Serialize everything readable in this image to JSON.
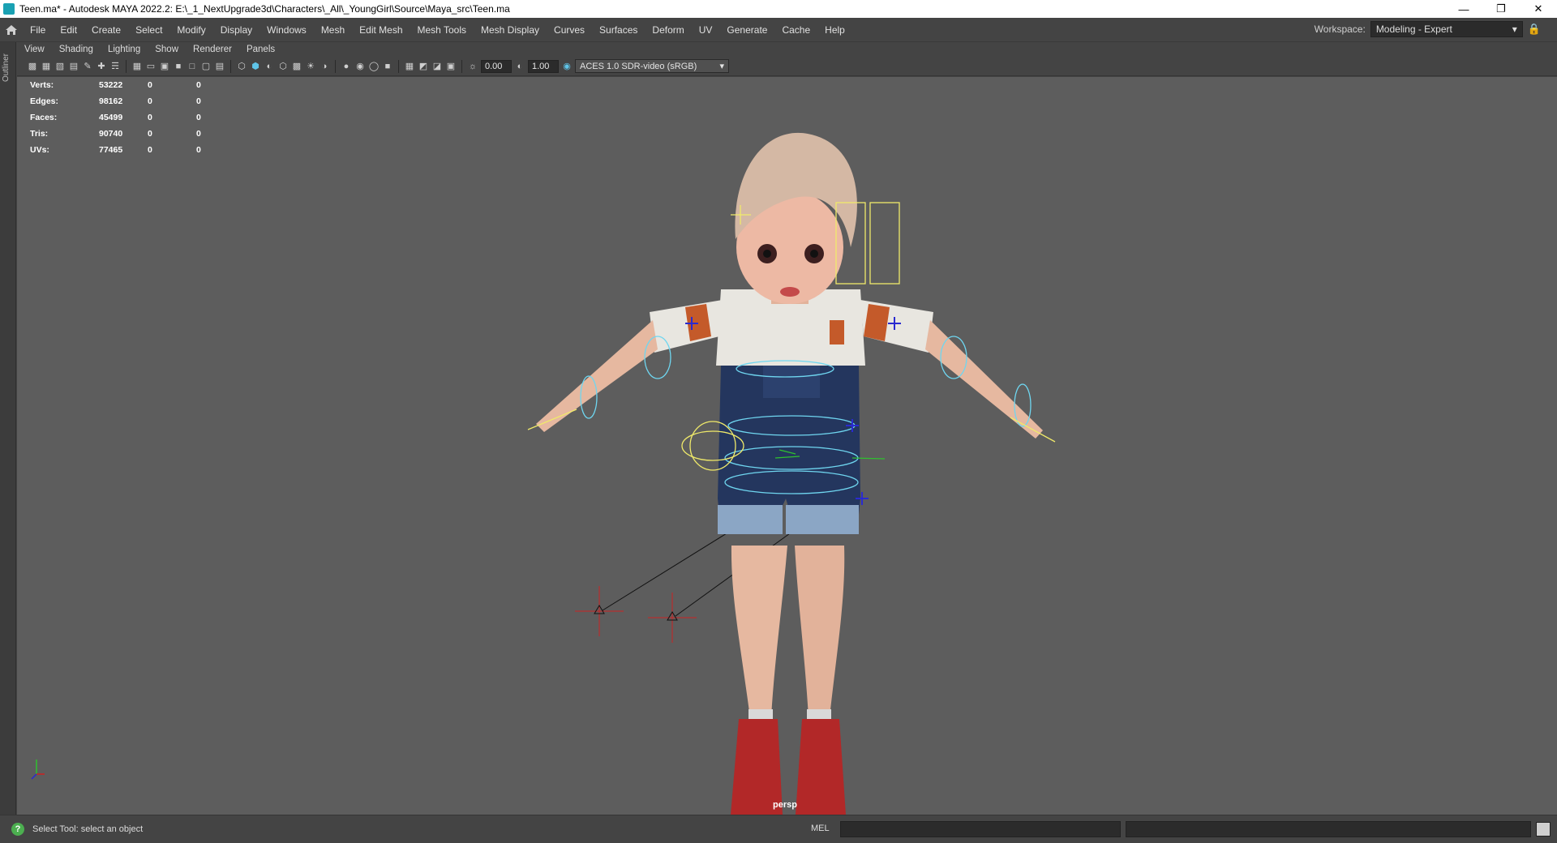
{
  "window": {
    "title": "Teen.ma* - Autodesk MAYA 2022.2: E:\\_1_NextUpgrade3d\\Characters\\_All\\_YoungGirl\\Source\\Maya_src\\Teen.ma",
    "buttons": [
      "minimize-icon",
      "restore-icon",
      "close-icon"
    ]
  },
  "menubar": {
    "items": [
      "File",
      "Edit",
      "Create",
      "Select",
      "Modify",
      "Display",
      "Windows",
      "Mesh",
      "Edit Mesh",
      "Mesh Tools",
      "Mesh Display",
      "Curves",
      "Surfaces",
      "Deform",
      "UV",
      "Generate",
      "Cache",
      "Help"
    ],
    "workspace_label": "Workspace:",
    "workspace_value": "Modeling - Expert"
  },
  "leftstrip": {
    "label": "Outliner"
  },
  "panel_menu": {
    "items": [
      "View",
      "Shading",
      "Lighting",
      "Show",
      "Renderer",
      "Panels"
    ]
  },
  "toolbar": {
    "exposure": "0.00",
    "gamma": "1.00",
    "color_space": "ACES 1.0 SDR-video (sRGB)"
  },
  "hud": {
    "rows": [
      {
        "label": "Verts:",
        "v1": "53222",
        "v2": "0",
        "v3": "0"
      },
      {
        "label": "Edges:",
        "v1": "98162",
        "v2": "0",
        "v3": "0"
      },
      {
        "label": "Faces:",
        "v1": "45499",
        "v2": "0",
        "v3": "0"
      },
      {
        "label": "Tris:",
        "v1": "90740",
        "v2": "0",
        "v3": "0"
      },
      {
        "label": "UVs:",
        "v1": "77465",
        "v2": "0",
        "v3": "0"
      }
    ]
  },
  "viewport": {
    "camera_label": "persp"
  },
  "statusbar": {
    "help_text": "Select Tool: select an object",
    "mel_label": "MEL"
  }
}
